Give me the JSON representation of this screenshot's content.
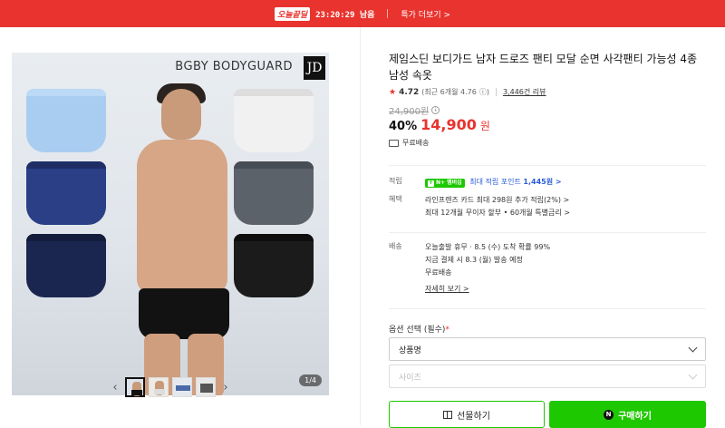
{
  "banner": {
    "badge": "오늘끝딜",
    "timer": "23:20:29 남음",
    "link": "특가 더보기 >"
  },
  "gallery": {
    "brand": "BGBY BODYGUARD",
    "logo": "JD",
    "counter": "1/4",
    "thumb_count": 4
  },
  "product": {
    "title": "제임스딘 보디가드 남자 드로즈 팬티 모달 순면 사각팬티 가능성 4종 남성 속옷",
    "rating": "4.72",
    "recent": "(최근 6개월 4.76",
    "reviews": "3,446건 리뷰",
    "original_price": "24,900원",
    "discount": "40%",
    "sale_price": "14,900",
    "won": "원",
    "free_shipping": "무료배송"
  },
  "benefits": {
    "points_label": "적립",
    "npay": "N+ 멤버십",
    "points_text": "최대 적립 포인트",
    "points_amount": "1,445원 >",
    "discount_label": "혜택",
    "card_line": "라인프렌즈 카드 최대 298원 추가 적립(2%) >",
    "installment_line": "최대 12개월 무이자 할부 • 60개월 특별금리 >"
  },
  "delivery": {
    "label": "배송",
    "line1": "오늘출발 휴무 · 8.5 (수) 도착 확률 99%",
    "line2": "지금 결제 시 8.3 (월) 발송 예정",
    "line3": "무료배송",
    "detail_link": "자세히 보기 >"
  },
  "options": {
    "label": "옵션 선택 (필수)",
    "required_mark": "*",
    "select1": "상품명",
    "select2": "사이즈"
  },
  "actions": {
    "gift": "선물하기",
    "buy": "구매하기",
    "n_icon": "N"
  },
  "colors": {
    "accent": "#e8332e",
    "naver_green": "#1ec800"
  }
}
